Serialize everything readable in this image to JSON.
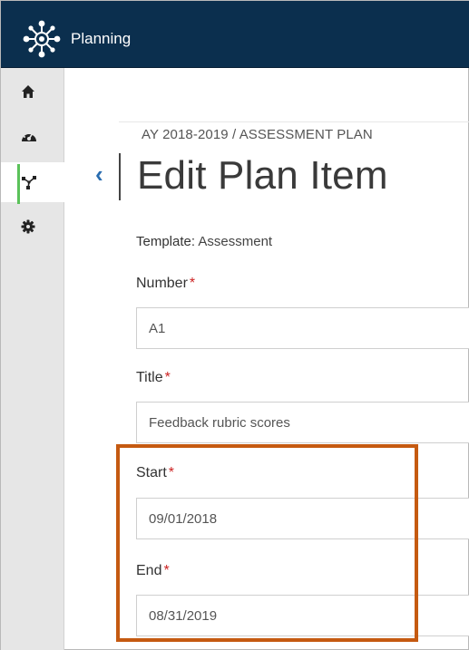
{
  "header": {
    "app_title": "Planning"
  },
  "sidebar": {
    "items": [
      {
        "name": "home",
        "icon": "home-icon"
      },
      {
        "name": "dashboard",
        "icon": "dashboard-icon"
      },
      {
        "name": "planning",
        "icon": "network-icon",
        "active": true
      },
      {
        "name": "settings",
        "icon": "gear-icon"
      }
    ]
  },
  "main": {
    "breadcrumb": "AY 2018-2019 / ASSESSMENT PLAN",
    "back_glyph": "‹",
    "title": "Edit Plan Item",
    "template_label": "Template:",
    "template_value": "Assessment",
    "required_mark": "*",
    "fields": {
      "number": {
        "label": "Number",
        "value": "A1"
      },
      "title": {
        "label": "Title",
        "value": "Feedback rubric scores"
      },
      "start": {
        "label": "Start",
        "value": "09/01/2018"
      },
      "end": {
        "label": "End",
        "value": "08/31/2019"
      }
    }
  },
  "colors": {
    "topbar": "#0b2f4e",
    "active_indicator": "#5bc25a",
    "required": "#cc2222",
    "highlight": "#c55a11",
    "back_link": "#2a6db0"
  }
}
